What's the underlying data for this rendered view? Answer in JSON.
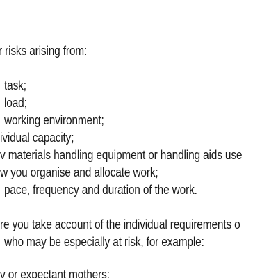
{
  "document": {
    "intro": "r risks arising from:",
    "risk_factors": [
      "task;",
      "load;",
      "working environment;",
      "ividual capacity;",
      "v materials handling equipment or handling aids use",
      "w you organise and allocate work;",
      "pace, frequency and duration of the work."
    ],
    "paragraph_lines": [
      "re you take account of the individual requirements o",
      "who may be especially at risk, for example:"
    ],
    "examples": [
      "v or expectant mothers;"
    ]
  }
}
